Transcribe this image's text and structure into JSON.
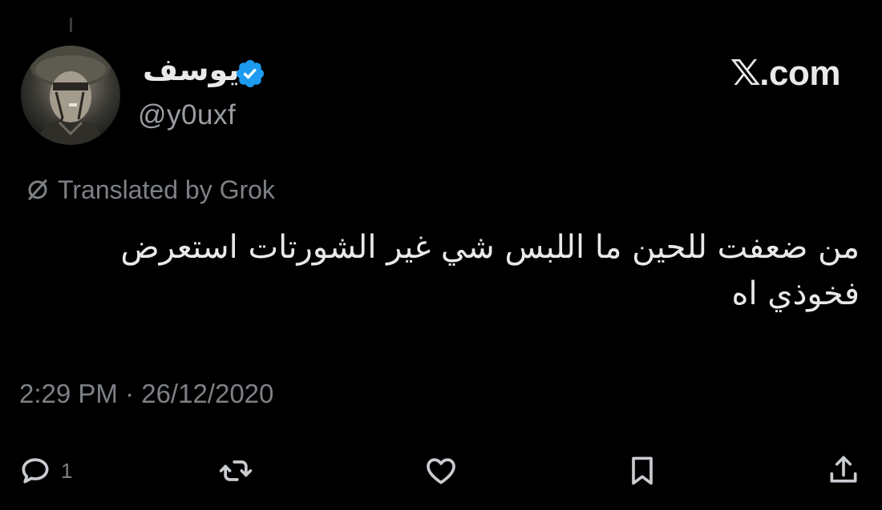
{
  "author": {
    "display_name": "يوسف",
    "handle": "@y0uxf",
    "verified": true
  },
  "brand": {
    "label": ".com",
    "x_mark": "𝕏"
  },
  "translation": {
    "label": "Translated by Grok",
    "icon": "grok-icon"
  },
  "tweet": {
    "text": "من ضعفت للحين ما اللبس شي غير الشورتات استعرض فخوذي اه",
    "timestamp": "2:29 PM · 26/12/2020"
  },
  "actions": {
    "reply": {
      "icon": "reply-icon",
      "count": "1"
    },
    "retweet": {
      "icon": "retweet-icon"
    },
    "like": {
      "icon": "heart-icon"
    },
    "bookmark": {
      "icon": "bookmark-icon"
    },
    "share": {
      "icon": "share-icon"
    }
  },
  "colors": {
    "background": "#000000",
    "text": "#e7e9ea",
    "muted": "#7d8186",
    "verified_blue": "#1d9bf0"
  }
}
